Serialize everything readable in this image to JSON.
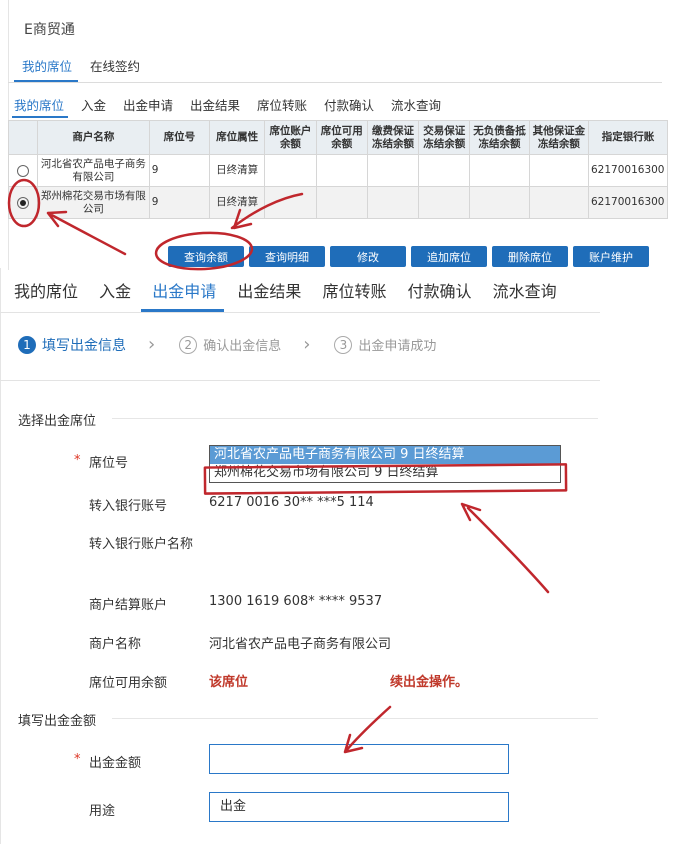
{
  "top": {
    "app_title": "E商贸通",
    "subtabs": [
      "我的席位",
      "在线签约"
    ],
    "tabs": [
      "我的席位",
      "入金",
      "出金申请",
      "出金结果",
      "席位转账",
      "付款确认",
      "流水查询"
    ],
    "table": {
      "headers": [
        "商户名称",
        "席位号",
        "席位属性",
        "席位账户余额",
        "席位可用余额",
        "缴费保证冻结余额",
        "交易保证冻结余额",
        "无负债备抵冻结余额",
        "其他保证金冻结余额",
        "指定银行账"
      ],
      "rows": [
        {
          "name": "河北省农产品电子商务有限公司",
          "seat": "9",
          "attr": "日终清算",
          "bank": "62170016300"
        },
        {
          "name": "郑州棉花交易市场有限公司",
          "seat": "9",
          "attr": "日终清算",
          "bank": "62170016300"
        }
      ],
      "selected_row": 1
    },
    "buttons": [
      "查询余额",
      "查询明细",
      "修改",
      "追加席位",
      "删除席位",
      "账户维护"
    ]
  },
  "bottom": {
    "tabs": [
      "我的席位",
      "入金",
      "出金申请",
      "出金结果",
      "席位转账",
      "付款确认",
      "流水查询"
    ],
    "active_tab": "出金申请",
    "steps": [
      {
        "num": "1",
        "label": "填写出金信息"
      },
      {
        "num": "2",
        "label": "确认出金信息"
      },
      {
        "num": "3",
        "label": "出金申请成功"
      }
    ],
    "section1": "选择出金席位",
    "fields": {
      "seat_label": "席位号",
      "seat_options": [
        "河北省农产品电子商务有限公司 9 日终结算",
        "郑州棉花交易市场有限公司 9 日终结算"
      ],
      "bank_acct_label": "转入银行账号",
      "bank_acct_value": "6217 0016 30** ***5 114",
      "bank_name_label": "转入银行账户名称",
      "merchant_acct_label": "商户结算账户",
      "merchant_acct_value": "1300 1619 608* **** 9537",
      "merchant_name_label": "商户名称",
      "merchant_name_value": "河北省农产品电子商务有限公司",
      "balance_label": "席位可用余额",
      "balance_warning": "该席位",
      "balance_warning_tail": "续出金操作。"
    },
    "section2": "填写出金金额",
    "amount_label": "出金金额",
    "amount_value": "",
    "purpose_label": "用途",
    "purpose_value": "出金",
    "required_mark": "*",
    "chevron": "›"
  },
  "colors": {
    "accent": "#2a78c8",
    "button": "#1f6db9",
    "annotation": "#c0272d"
  }
}
